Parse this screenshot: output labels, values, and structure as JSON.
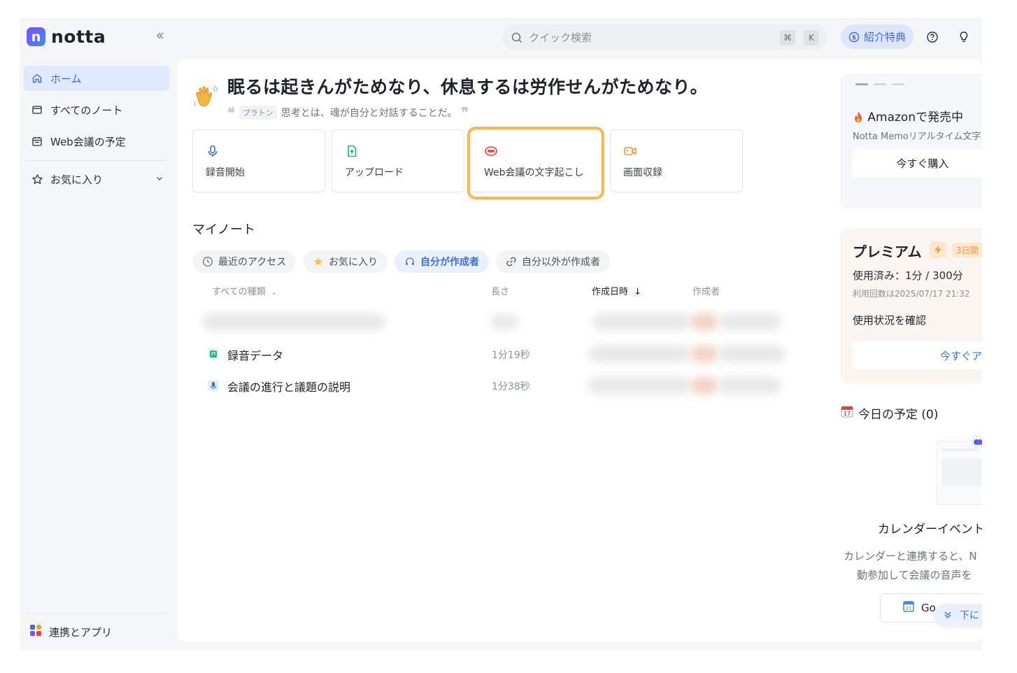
{
  "brand": {
    "logo_letter": "n",
    "name": "notta"
  },
  "sidebar": {
    "collapse_icon": "double-chevron-left-icon",
    "items": [
      {
        "label": "ホーム",
        "icon": "home-icon",
        "active": true
      },
      {
        "label": "すべてのノート",
        "icon": "folder-icon",
        "active": false
      },
      {
        "label": "Web会議の予定",
        "icon": "calendar-icon",
        "active": false
      }
    ],
    "favorites": {
      "label": "お気に入り",
      "icon": "star-icon"
    },
    "integrations": {
      "label": "連携とアプリ",
      "icon": "apps-icon"
    }
  },
  "topbar": {
    "search_placeholder": "クイック検索",
    "shortcut_cmd": "⌘",
    "shortcut_key": "K",
    "referral_label": "紹介特典"
  },
  "quote": {
    "title": "眠るは起きんがためなり、休息するは労作せんがためなり。",
    "author": "プラトン",
    "text": "思考とは、魂が自分と対話することだ。"
  },
  "actions": [
    {
      "label": "録音開始",
      "icon": "microphone-icon",
      "color": "#3b6fe0"
    },
    {
      "label": "アップロード",
      "icon": "upload-file-icon",
      "color": "#20b28a"
    },
    {
      "label": "Web会議の文字起こし",
      "icon": "meeting-link-icon",
      "color": "#e0443e"
    },
    {
      "label": "画面収録",
      "icon": "video-camera-icon",
      "color": "#f39a2d"
    }
  ],
  "notes": {
    "title": "マイノート",
    "filters": [
      {
        "label": "最近のアクセス",
        "icon": "clock-icon",
        "active": false
      },
      {
        "label": "お気に入り",
        "icon": "star-icon",
        "active": false
      },
      {
        "label": "自分が作成者",
        "icon": "headset-icon",
        "active": true
      },
      {
        "label": "自分以外が作成者",
        "icon": "link-icon",
        "active": false
      }
    ],
    "columns": {
      "type": "すべての種類",
      "length": "長さ",
      "created": "作成日時",
      "creator": "作成者"
    },
    "rows": [
      {
        "name": "",
        "length": ""
      },
      {
        "name": "録音データ",
        "length": "1分19秒",
        "icon": "audio-file-icon",
        "color": "#20b28a"
      },
      {
        "name": "会議の進行と議題の説明",
        "length": "1分38秒",
        "icon": "microphone-file-icon",
        "color": "#3b6fe0"
      }
    ]
  },
  "promo": {
    "title": "Amazonで発売中",
    "desc": "Notta Memoリアルタイム文字",
    "button": "今すぐ購入"
  },
  "plan": {
    "title": "プレミアム",
    "trial": "3日間",
    "used": "使用済み：1分 / 300分",
    "reset": "利用回数は2025/07/17 21:32",
    "link": "使用状況を確認",
    "upgrade": "今すぐアッ"
  },
  "today": {
    "title": "今日の予定 (0)",
    "event_title": "カレンダーイベント",
    "desc_line1": "カレンダーと連携すると、N",
    "desc_line2": "動参加して会議の音声を",
    "google_button": "Go",
    "scroll_down": "下に"
  }
}
